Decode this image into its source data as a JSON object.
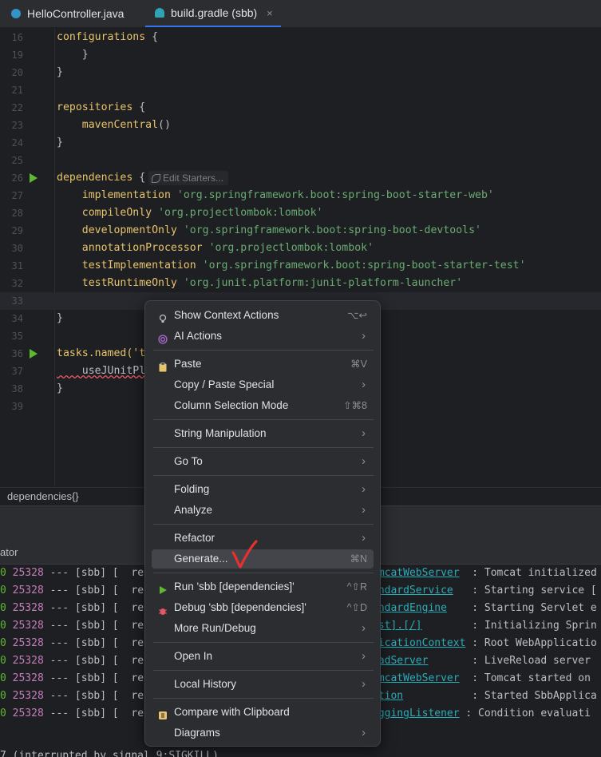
{
  "tabs": [
    {
      "label": "HelloController.java",
      "active": false,
      "icon": "java-class-icon"
    },
    {
      "label": "build.gradle (sbb)",
      "active": true,
      "icon": "gradle-elephant-icon",
      "close": "×"
    }
  ],
  "editor": {
    "lines": [
      {
        "num": "16",
        "text": "configurations {"
      },
      {
        "num": "19",
        "text": "    }"
      },
      {
        "num": "20",
        "text": "}"
      },
      {
        "num": "21",
        "text": ""
      },
      {
        "num": "22",
        "text": "repositories {"
      },
      {
        "num": "23",
        "text": "    mavenCentral()"
      },
      {
        "num": "24",
        "text": "}"
      },
      {
        "num": "25",
        "text": ""
      },
      {
        "num": "26",
        "text": "dependencies {"
      },
      {
        "num": "27",
        "text": "    implementation 'org.springframework.boot:spring-boot-starter-web'"
      },
      {
        "num": "28",
        "text": "    compileOnly 'org.projectlombok:lombok'"
      },
      {
        "num": "29",
        "text": "    developmentOnly 'org.springframework.boot:spring-boot-devtools'"
      },
      {
        "num": "30",
        "text": "    annotationProcessor 'org.projectlombok:lombok'"
      },
      {
        "num": "31",
        "text": "    testImplementation 'org.springframework.boot:spring-boot-starter-test'"
      },
      {
        "num": "32",
        "text": "    testRuntimeOnly 'org.junit.platform:junit-platform-launcher'"
      },
      {
        "num": "33",
        "text": ""
      },
      {
        "num": "34",
        "text": "}"
      },
      {
        "num": "35",
        "text": ""
      },
      {
        "num": "36",
        "text": "tasks.named('t"
      },
      {
        "num": "37",
        "text": "    useJUnitPl"
      },
      {
        "num": "38",
        "text": "}"
      },
      {
        "num": "39",
        "text": ""
      }
    ],
    "inlay_hint": "Edit Starters...",
    "breadcrumb": "dependencies{}"
  },
  "panel": {
    "title_fragment": "ator"
  },
  "console": {
    "rows": [
      {
        "left": "0 ",
        "pid": "25328",
        "mid": " --- [sbb] [  res",
        "cls": "omcatWebServer",
        "msg": "  : Tomcat initialized"
      },
      {
        "left": "0 ",
        "pid": "25328",
        "mid": " --- [sbb] [  res",
        "cls": "andardService",
        "msg": "   : Starting service ["
      },
      {
        "left": "0 ",
        "pid": "25328",
        "mid": " --- [sbb] [  res",
        "cls": "andardEngine",
        "msg": "    : Starting Servlet e"
      },
      {
        "left": "0 ",
        "pid": "25328",
        "mid": " --- [sbb] [  res",
        "cls": "ost].[/]",
        "msg": "        : Initializing Sprin"
      },
      {
        "left": "0 ",
        "pid": "25328",
        "mid": " --- [sbb] [  res",
        "cls": "licationContext",
        "msg": " : Root WebApplicatio"
      },
      {
        "left": "0 ",
        "pid": "25328",
        "mid": " --- [sbb] [  res",
        "cls": "oadServer",
        "msg": "       : LiveReload server"
      },
      {
        "left": "0 ",
        "pid": "25328",
        "mid": " --- [sbb] [  res",
        "cls": "omcatWebServer",
        "msg": "  : Tomcat started on"
      },
      {
        "left": "0 ",
        "pid": "25328",
        "mid": " --- [sbb] [  res",
        "cls": "ation",
        "msg": "           : Started SbbApplica"
      },
      {
        "left": "0 ",
        "pid": "25328",
        "mid": " --- [sbb] [  res",
        "cls": "oggingListener",
        "msg": " : Condition evaluati"
      }
    ],
    "tail": "7 (interrupted by signal 9:SIGKILL)"
  },
  "context_menu": {
    "items": [
      {
        "label": "Show Context Actions",
        "shortcut": "⌥↩",
        "icon": "lightbulb-icon"
      },
      {
        "label": "AI Actions",
        "submenu": "›",
        "icon": "ai-spiral-icon"
      },
      {
        "label": "Paste",
        "shortcut": "⌘V",
        "icon": "clipboard-icon"
      },
      {
        "label": "Copy / Paste Special",
        "submenu": "›"
      },
      {
        "label": "Column Selection Mode",
        "shortcut": "⇧⌘8"
      },
      {
        "label": "String Manipulation",
        "submenu": "›"
      },
      {
        "label": "Go To",
        "submenu": "›"
      },
      {
        "label": "Folding",
        "submenu": "›"
      },
      {
        "label": "Analyze",
        "submenu": "›"
      },
      {
        "label": "Refactor",
        "submenu": "›"
      },
      {
        "label": "Generate...",
        "shortcut": "⌘N",
        "selected": true
      },
      {
        "label": "Run 'sbb [dependencies]'",
        "shortcut": "^⇧R",
        "icon": "run-icon"
      },
      {
        "label": "Debug 'sbb [dependencies]'",
        "shortcut": "^⇧D",
        "icon": "debug-bug-icon"
      },
      {
        "label": "More Run/Debug",
        "submenu": "›"
      },
      {
        "label": "Open In",
        "submenu": "›"
      },
      {
        "label": "Local History",
        "submenu": "›"
      },
      {
        "label": "Compare with Clipboard",
        "icon": "compare-icon"
      },
      {
        "label": "Diagrams",
        "submenu": "›"
      }
    ]
  },
  "colors": {
    "background": "#1e1f22",
    "keyword": "#e8c46c",
    "string": "#6aab73",
    "run_green": "#5fb832",
    "annotation_red": "#e5312f",
    "accent": "#3574f0"
  }
}
